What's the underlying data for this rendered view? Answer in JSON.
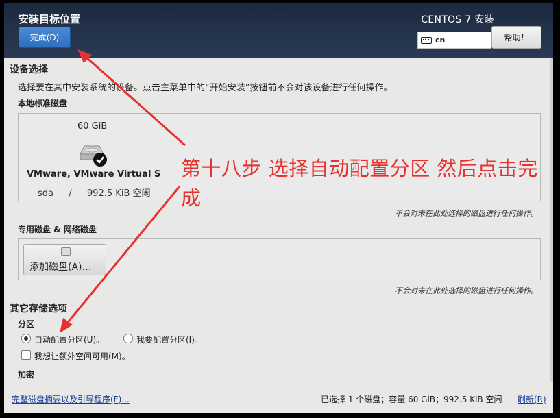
{
  "header": {
    "title": "安装目标位置",
    "done_button": "完成(D)",
    "product": "CENTOS 7 安装",
    "keyboard_layout": "cn",
    "help_button": "帮助！"
  },
  "device_selection": {
    "title": "设备选择",
    "description": "选择要在其中安装系统的设备。点击主菜单中的“开始安装”按钮前不会对该设备进行任何操作。",
    "local_disks_title": "本地标准磁盘",
    "disk": {
      "size": "60 GiB",
      "name": "VMware, VMware Virtual S",
      "device": "sda",
      "separator": "/",
      "free": "992.5 KiB 空闲"
    },
    "local_note": "不会对未在此处选择的磁盘进行任何操作。",
    "network_disks_title": "专用磁盘 & 网络磁盘",
    "add_disk_button": "添加磁盘(A)…",
    "network_note": "不会对未在此处选择的磁盘进行任何操作。"
  },
  "other_storage": {
    "title": "其它存储选项",
    "partition_title": "分区",
    "auto_partition": "自动配置分区(U)。",
    "manual_partition": "我要配置分区(I)。",
    "extra_space": "我想让额外空间可用(M)。",
    "encryption_title": "加密"
  },
  "footer": {
    "summary_link": "完整磁盘摘要以及引导程序(F)...",
    "status": "已选择 1 个磁盘；容量 60 GiB；992.5 KiB 空闲",
    "refresh_link": "刷新(R)"
  },
  "annotation": {
    "text": "第十八步 选择自动配置分区 然后点击完成",
    "color": "#e8302e"
  },
  "colors": {
    "header_bg": "#1c2a3f",
    "done_button": "#3a7bd0",
    "link": "#1a3fa0"
  },
  "state": {
    "partitioning": "auto",
    "extra_space_checked": false,
    "disk_selected": true
  }
}
